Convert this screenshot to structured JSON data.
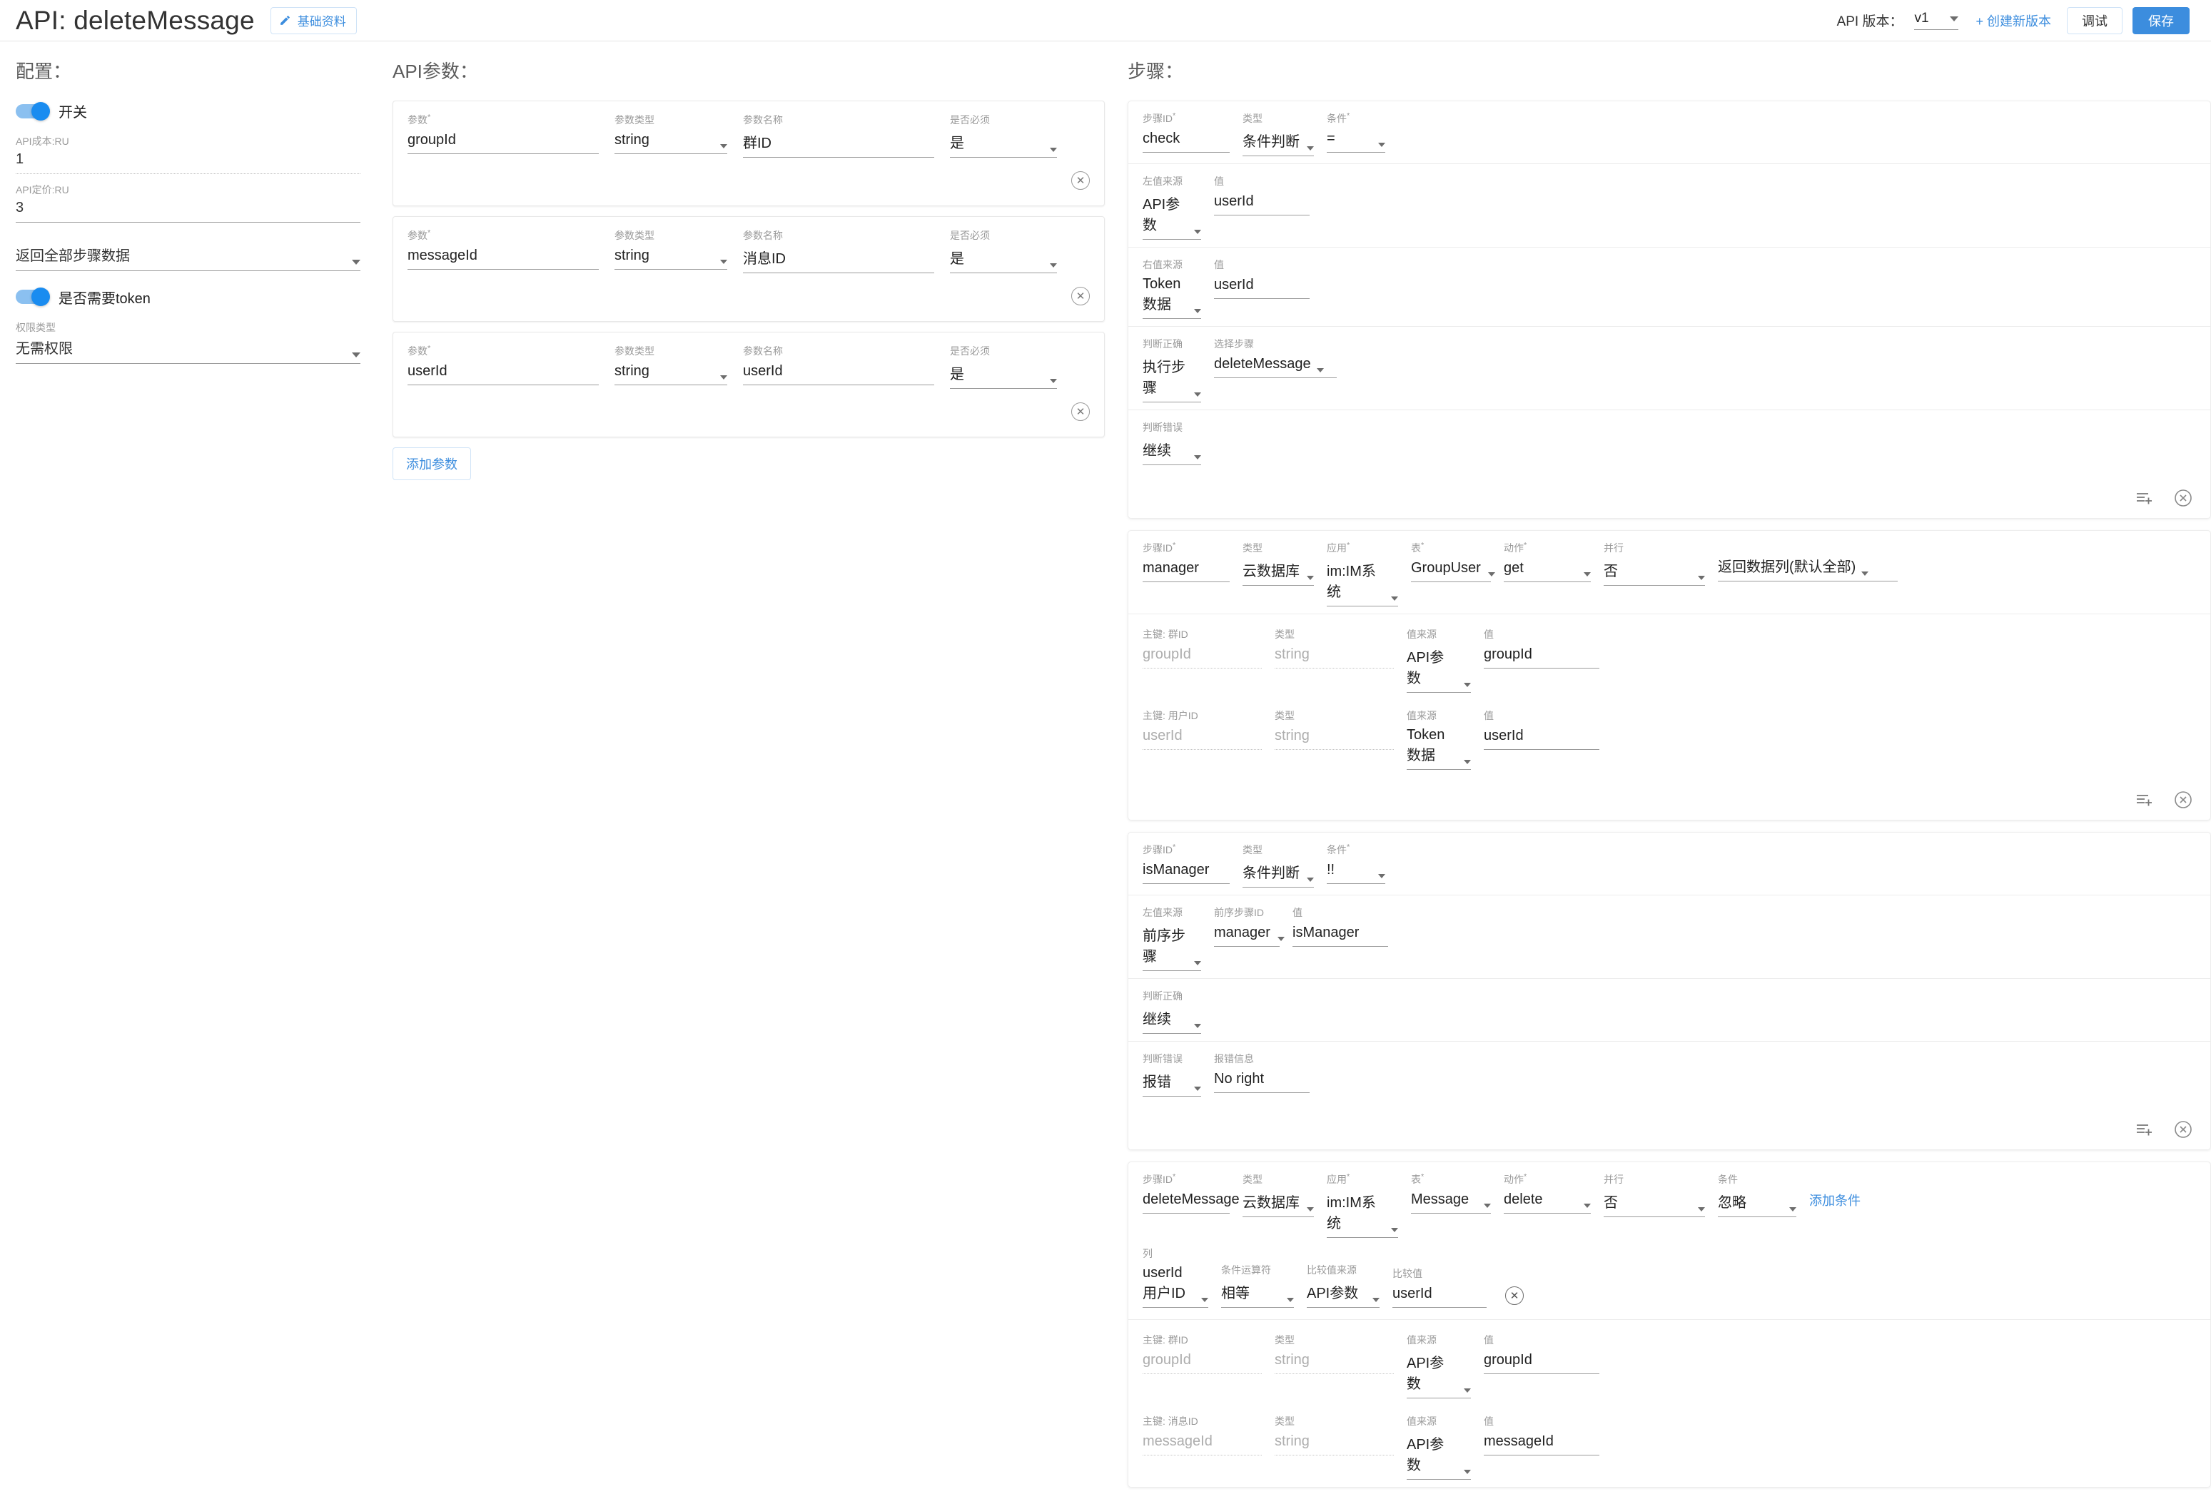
{
  "header": {
    "title": "API: deleteMessage",
    "basic_info_button": "基础资料",
    "version_label": "API 版本：",
    "version_value": "v1",
    "new_version_link": "+ 创建新版本",
    "debug_button": "调试",
    "save_button": "保存",
    "accent_color": "#3c8dde"
  },
  "config": {
    "section_title": "配置：",
    "switch_label": "开关",
    "switch_on": true,
    "cost_label": "API成本:RU",
    "cost_value": "1",
    "price_label": "API定价:RU",
    "price_value": "3",
    "return_select_value": "返回全部步骤数据",
    "token_switch_label": "是否需要token",
    "token_switch_on": true,
    "auth_label": "权限类型",
    "auth_value": "无需权限"
  },
  "params": {
    "section_title": "API参数：",
    "labels": {
      "name": "参数",
      "type": "参数类型",
      "display": "参数名称",
      "required": "是否必须"
    },
    "add_button": "添加参数",
    "rows": [
      {
        "name": "groupId",
        "type": "string",
        "display": "群ID",
        "required": "是"
      },
      {
        "name": "messageId",
        "type": "string",
        "display": "消息ID",
        "required": "是"
      },
      {
        "name": "userId",
        "type": "string",
        "display": "userId",
        "required": "是"
      }
    ]
  },
  "steps": {
    "section_title": "步骤：",
    "labels": {
      "step_id": "步骤ID",
      "type": "类型",
      "condition": "条件",
      "left_source": "左值来源",
      "right_source": "右值来源",
      "value": "值",
      "on_true": "判断正确",
      "on_false": "判断错误",
      "select_step": "选择步骤",
      "prev_step_id": "前序步骤ID",
      "error_message": "报错信息",
      "app": "应用",
      "table": "表",
      "action": "动作",
      "parallel": "并行",
      "return_columns": "返回数据列(默认全部)",
      "column": "列",
      "operator": "条件运算符",
      "compare_source": "比较值来源",
      "compare_value": "比较值",
      "add_condition": "添加条件"
    },
    "step1": {
      "step_id": "check",
      "type": "条件判断",
      "condition": "=",
      "left_source": "API参数",
      "left_value": "userId",
      "right_source": "Token数据",
      "right_value": "userId",
      "on_true": "执行步骤",
      "select_step": "deleteMessage",
      "on_false": "继续"
    },
    "step2": {
      "step_id": "manager",
      "type": "云数据库",
      "app": "im:IM系统",
      "table": "GroupUser",
      "action": "get",
      "parallel": "否",
      "return_columns": "返回数据列(默认全部)",
      "keys": [
        {
          "label": "主键: 群ID",
          "name": "groupId",
          "type": "string",
          "source": "API参数",
          "value": "groupId"
        },
        {
          "label": "主键: 用户ID",
          "name": "userId",
          "type": "string",
          "source": "Token数据",
          "value": "userId"
        }
      ]
    },
    "step3": {
      "step_id": "isManager",
      "type": "条件判断",
      "condition": "!!",
      "left_source": "前序步骤",
      "prev_step_id": "manager",
      "left_value": "isManager",
      "on_true": "继续",
      "on_false": "报错",
      "error_message": "No right"
    },
    "step4": {
      "step_id": "deleteMessage",
      "type": "云数据库",
      "app": "im:IM系统",
      "table": "Message",
      "action": "delete",
      "parallel": "否",
      "condition": "忽略",
      "add_condition": "添加条件",
      "conditions": [
        {
          "column": "userId 用户ID",
          "operator": "相等",
          "compare_source": "API参数",
          "compare_value": "userId"
        }
      ],
      "keys": [
        {
          "label": "主键: 群ID",
          "name": "groupId",
          "type": "string",
          "source": "API参数",
          "value": "groupId"
        },
        {
          "label": "主键: 消息ID",
          "name": "messageId",
          "type": "string",
          "source": "API参数",
          "value": "messageId"
        }
      ]
    }
  }
}
